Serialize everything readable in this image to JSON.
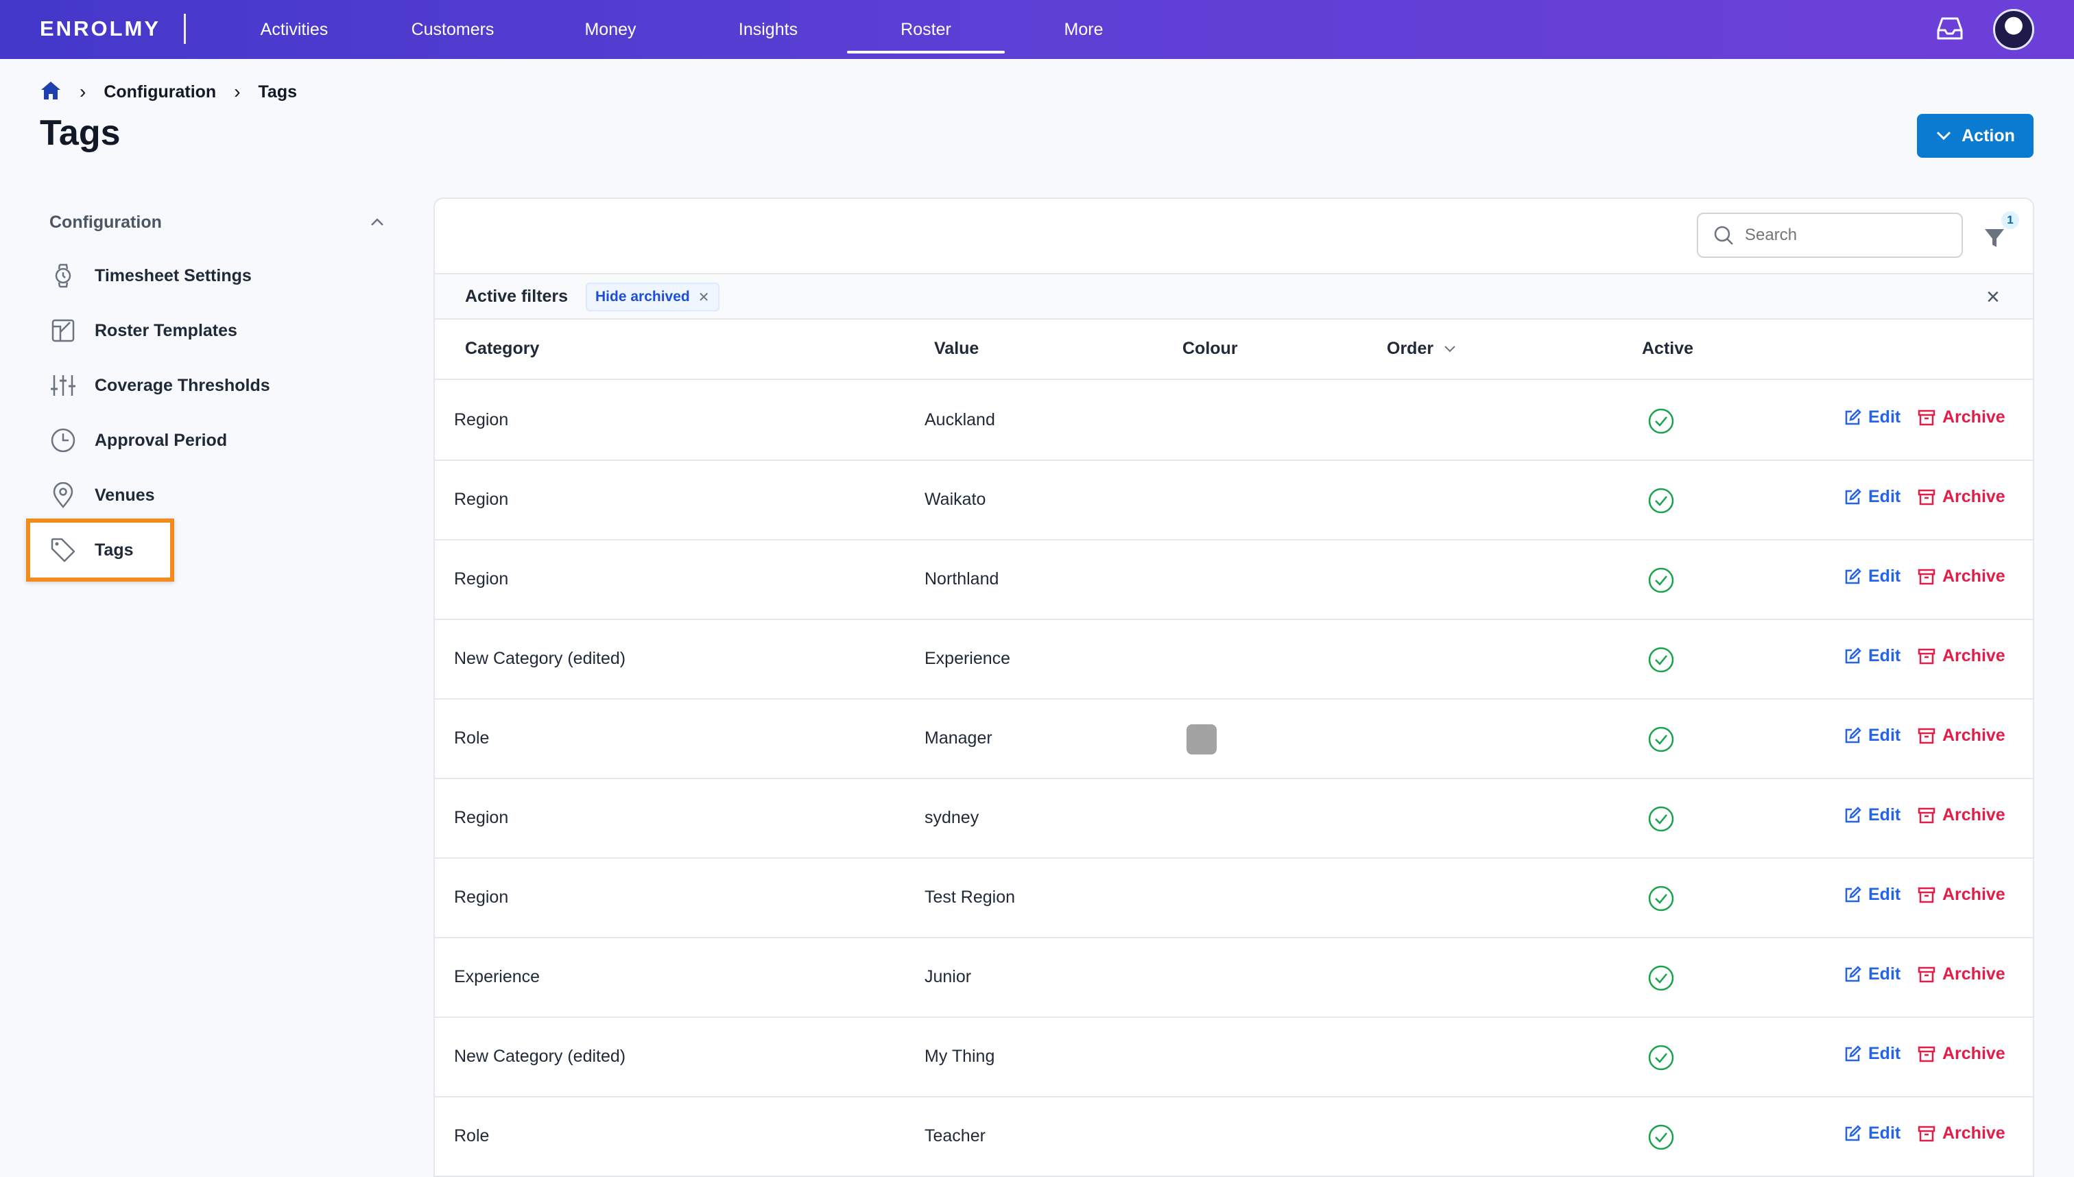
{
  "nav": {
    "logo": "ENROLMY",
    "items": [
      "Activities",
      "Customers",
      "Money",
      "Insights",
      "Roster",
      "More"
    ],
    "active": "Roster"
  },
  "breadcrumb": {
    "current_section": "Configuration",
    "current_page": "Tags"
  },
  "page": {
    "title": "Tags",
    "action_label": "Action"
  },
  "sidebar": {
    "section_label": "Configuration",
    "items": [
      {
        "label": "Timesheet Settings",
        "icon": "watch-icon"
      },
      {
        "label": "Roster Templates",
        "icon": "template-icon"
      },
      {
        "label": "Coverage Thresholds",
        "icon": "sliders-icon"
      },
      {
        "label": "Approval Period",
        "icon": "clock-icon"
      },
      {
        "label": "Venues",
        "icon": "map-pin-icon"
      },
      {
        "label": "Tags",
        "icon": "tag-icon"
      }
    ],
    "selected": "Tags"
  },
  "table": {
    "search_placeholder": "Search",
    "filter_count": "1",
    "active_filters_label": "Active filters",
    "filter_chip": "Hide archived",
    "columns": {
      "category": "Category",
      "value": "Value",
      "colour": "Colour",
      "order": "Order",
      "active": "Active"
    },
    "edit_label": "Edit",
    "archive_label": "Archive",
    "rows": [
      {
        "category": "Region",
        "value": "Auckland",
        "colour": null,
        "active": true
      },
      {
        "category": "Region",
        "value": "Waikato",
        "colour": null,
        "active": true
      },
      {
        "category": "Region",
        "value": "Northland",
        "colour": null,
        "active": true
      },
      {
        "category": "New Category (edited)",
        "value": "Experience",
        "colour": null,
        "active": true
      },
      {
        "category": "Role",
        "value": "Manager",
        "colour": "#a3a3a3",
        "active": true
      },
      {
        "category": "Region",
        "value": "sydney",
        "colour": null,
        "active": true
      },
      {
        "category": "Region",
        "value": "Test Region",
        "colour": null,
        "active": true
      },
      {
        "category": "Experience",
        "value": "Junior",
        "colour": null,
        "active": true
      },
      {
        "category": "New Category (edited)",
        "value": "My Thing",
        "colour": null,
        "active": true
      },
      {
        "category": "Role",
        "value": "Teacher",
        "colour": null,
        "active": true
      }
    ]
  },
  "colors": {
    "nav_start": "#4338ca",
    "nav_end": "#6d3fd8",
    "primary": "#0a7bd0",
    "edit": "#2563eb",
    "archive": "#e11d48",
    "active_check": "#16a34a",
    "highlight": "#f28a1c"
  }
}
